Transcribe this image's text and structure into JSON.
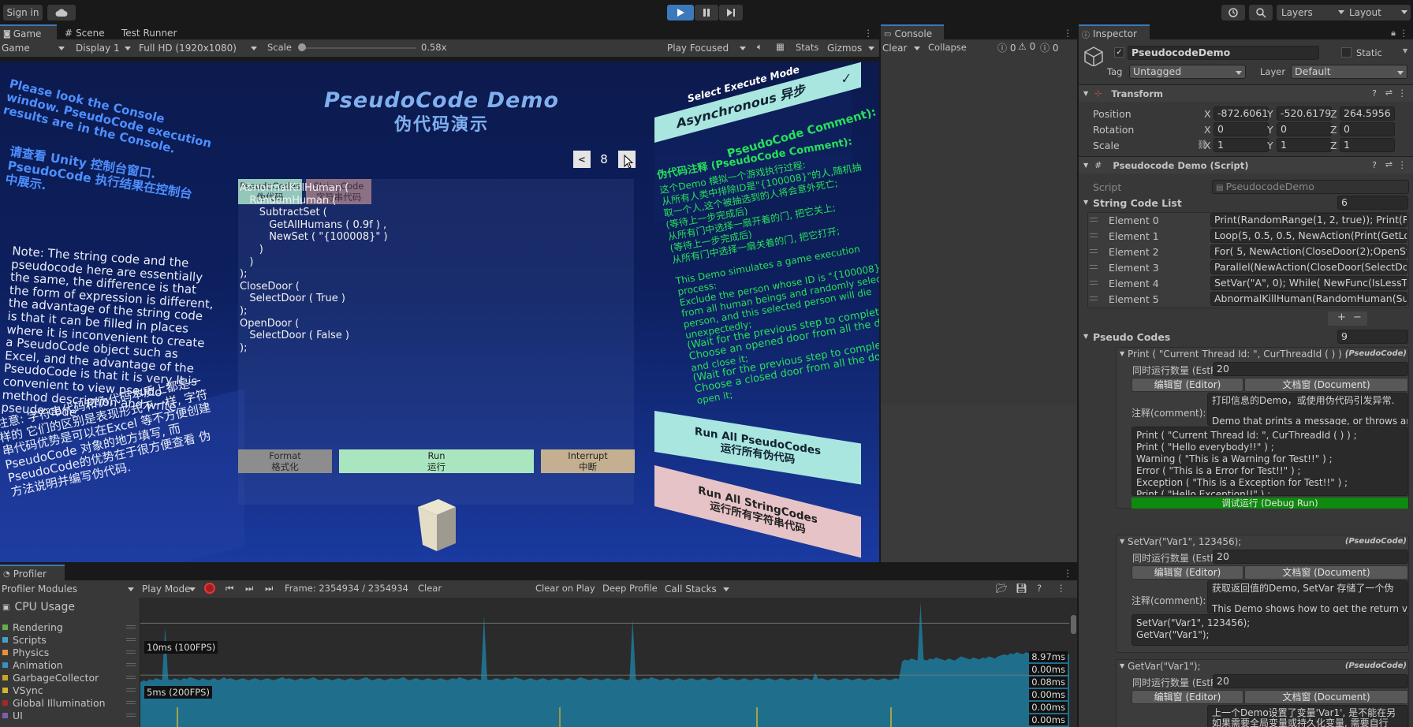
{
  "topbar": {
    "signin": "Sign in",
    "layers": "Layers",
    "layout": "Layout"
  },
  "game": {
    "tab_game": "Game",
    "tab_scene": "Scene",
    "tab_test_runner": "Test Runner",
    "mode": "Game",
    "display": "Display 1",
    "resolution": "Full HD (1920x1080)",
    "scale_label": "Scale",
    "scale_value": "0.58x",
    "play_focused": "Play Focused",
    "stats": "Stats",
    "gizmos": "Gizmos",
    "title_en": "PseudoCode Demo",
    "title_cn": "伪代码演示",
    "left_en": "Please look the Console window. PseudoCode execution results are in the Console.",
    "left_cn": "请查看 Unity 控制台窗口. PseudoCode 执行结果在控制台中展示.",
    "note_en": "Note: The string code and the pseudocode here are essentially the same, the difference is that the form of expression is different, the advantage of the string code is that it can be filled in places where it is inconvenient to create a PseudoCode object such as Excel, and the advantage of the PseudoCode is that it is very It is convenient to view pseudo method description and write pseudo code.",
    "note_cn": "注意: 字符串代码和伪代码本质上都是一样的 它们的区别是表现形式不一样, 字符串代码优势是可以在Excel 等不方便创建 PseudoCode 对象的地方填写, 而PseudoCode的优势在于很方便查看 伪方法说明并编写伪代码.",
    "tab1_en": "PseudoCodes",
    "tab1_cn": "伪代码",
    "tab2_en": "StringCode",
    "tab2_cn": "字符串代码",
    "prev": "<",
    "page": "8",
    "next": ">",
    "code_lines": [
      "AbnormalKillHuman (",
      "   RandomHuman (",
      "      SubtractSet (",
      "         GetAllHumans ( 0.9f ) ,",
      "         NewSet ( \"{100008}\" )",
      "      )",
      "   )",
      ");",
      "CloseDoor (",
      "   SelectDoor ( True )",
      ");",
      "OpenDoor (",
      "   SelectDoor ( False )",
      ");"
    ],
    "format_en": "Format",
    "format_cn": "格式化",
    "run_en": "Run",
    "run_cn": "运行",
    "interrupt_en": "Interrupt",
    "interrupt_cn": "中断",
    "select_mode": "Select Execute Mode",
    "async": "Asynchronous 异步",
    "check": "✓",
    "comment_title": "PseudoCode Comment):",
    "comment_cn": [
      "伪代码注释 (PseudoCode Comment):",
      "这个Demo 模拟一个游戏执行过程:",
      "从所有人类中排除ID是\"{100008}\"的人,随机抽",
      "取一个人,这个被抽选到的人将会意外死亡;",
      "(等待上一步完成后)",
      "从所有门中选择一扇开着的门, 把它关上;",
      "(等待上一步完成后)",
      "从所有门中选择一扇关着的门, 把它打开;"
    ],
    "comment_en": [
      "This Demo simulates a game execution",
      "process:",
      "Exclude the person whose ID is \"{100008}\"",
      "from all human beings and randomly select a",
      "person, and this selected person will die",
      "unexpectedly;",
      "(Wait for the previous step to complete)",
      "Choose an opened door from all the doors",
      "and close it;",
      "(Wait for the previous step to complete)",
      "Choose a closed door from all the doors and",
      "open it;"
    ],
    "run_all_pc_en": "Run All PseudoCodes",
    "run_all_pc_cn": "运行所有伪代码",
    "run_all_sc_en": "Run All StringCodes",
    "run_all_sc_cn": "运行所有字符串代码"
  },
  "console": {
    "tab": "Console",
    "clear": "Clear",
    "collapse": "Collapse",
    "c1": "0",
    "c2": "0",
    "c3": "0"
  },
  "inspector": {
    "tab": "Inspector",
    "object_name": "PseudocodeDemo",
    "static": "Static",
    "tag_label": "Tag",
    "tag": "Untagged",
    "layer_label": "Layer",
    "layer": "Default",
    "transform": "Transform",
    "position_label": "Position",
    "pos": {
      "x": "-872.6061",
      "y": "-520.6179",
      "z": "264.5956"
    },
    "rotation_label": "Rotation",
    "rot": {
      "x": "0",
      "y": "0",
      "z": "0"
    },
    "scale_label": "Scale",
    "scl": {
      "x": "1",
      "y": "1",
      "z": "1"
    },
    "script_component": "Pseudocode Demo (Script)",
    "script_label": "Script",
    "script_value": "PseudocodeDemo",
    "string_code_list": "String Code List",
    "string_code_count": "6",
    "elements": [
      {
        "label": "Element 0",
        "value": "Print(RandomRange(1, 2, true)); Print(Ran"
      },
      {
        "label": "Element 1",
        "value": "Loop(5, 0.5,  0.5, NewAction(Print(GetLo"
      },
      {
        "label": "Element 2",
        "value": "For( 5, NewAction(CloseDoor(2);OpenStr"
      },
      {
        "label": "Element 3",
        "value": "Parallel(NewAction(CloseDoor(SelectDo"
      },
      {
        "label": "Element 4",
        "value": "SetVar(\"A\", 0); While( NewFunc(IsLessTo"
      },
      {
        "label": "Element 5",
        "value": "AbnormalKillHuman(RandomHuman(Sub"
      }
    ],
    "plus": "+",
    "minus": "−",
    "pseudo_codes": "Pseudo Codes",
    "pseudo_count": "9",
    "tag_pc": "(PseudoCode)",
    "concurrent_label": "同时运行数量 (EstRun",
    "concurrent": "20",
    "editor_btn": "编辑窗 (Editor)",
    "doc_btn": "文档窗 (Document)",
    "comment_label": "注释(comment):",
    "pc1_title": "Print ( \"Current Thread Id: \", CurThreadId ( ) ) ;",
    "pc1_comment": "打印信息的Demo，或使用伪代码引发异常.\n\nDemo that prints a message, or throws ar",
    "pc1_code": "Print ( \"Current Thread Id: \", CurThreadId ( ) ) ;\nPrint ( \"Hello everybody!!\" ) ;\nWarning ( \"This is a Warning for Test!!\" ) ;\nError ( \"This is a Error for Test!!\" ) ;\nException ( \"This is a Exception for Test!!\" ) ;\nPrint ( \"Hello Exception!!\" ) ;",
    "debug_run": "调试运行 (Debug Run)",
    "pc2_title": "SetVar(\"Var1\", 123456);",
    "pc2_comment": "获取返回值的Demo, SetVar 存储了一个伪\n\nThis Demo shows how to get the return v",
    "pc2_code": "SetVar(\"Var1\", 123456);\nGetVar(\"Var1\");",
    "pc3_title": "GetVar(\"Var1\");",
    "pc3_comment": "上一个Demo设置了变量'Var1', 是不能在另\n如果需要全局变量或持久化变量, 需要自行"
  },
  "profiler": {
    "tab": "Profiler",
    "modules": "Profiler Modules",
    "play_mode": "Play Mode",
    "frame": "Frame: 2354934 / 2354934",
    "clear": "Clear",
    "clear_on_play": "Clear on Play",
    "deep_profile": "Deep Profile",
    "call_stacks": "Call Stacks",
    "cpu_usage": "CPU Usage",
    "legend": [
      {
        "name": "Rendering",
        "color": "#6aa84f"
      },
      {
        "name": "Scripts",
        "color": "#3fa3c8"
      },
      {
        "name": "Physics",
        "color": "#e69138"
      },
      {
        "name": "Animation",
        "color": "#3a8fc4"
      },
      {
        "name": "GarbageCollector",
        "color": "#c9a227"
      },
      {
        "name": "VSync",
        "color": "#d4b430"
      },
      {
        "name": "Global Illumination",
        "color": "#a32828"
      },
      {
        "name": "UI",
        "color": "#7b5db3"
      }
    ],
    "label_10ms": "10ms (100FPS)",
    "label_5ms": "5ms (200FPS)",
    "readouts": [
      "8.97ms",
      "0.00ms",
      "0.08ms",
      "0.00ms",
      "0.00ms",
      "0.00ms"
    ]
  },
  "chart_data": {
    "type": "area",
    "title": "CPU Usage",
    "ylim": [
      0,
      12
    ],
    "reference_lines": [
      {
        "label": "10ms (100FPS)",
        "y": 10
      },
      {
        "label": "5ms (200FPS)",
        "y": 5
      }
    ],
    "series": [
      {
        "name": "Scripts",
        "values": [
          4.3,
          4.5,
          4.4,
          4.6,
          4.5,
          4.7,
          4.6,
          4.5,
          9.6,
          4.6,
          4.5,
          4.7,
          4.6,
          4.5,
          4.7,
          4.6,
          4.8,
          4.7,
          4.6,
          4.5,
          4.7,
          4.6,
          4.5,
          4.6,
          4.7,
          4.5,
          4.6,
          4.8,
          4.6,
          4.7,
          4.6,
          4.5,
          4.6,
          4.7,
          4.6,
          4.5,
          4.6,
          4.7,
          4.6,
          4.5,
          4.6,
          4.7,
          4.6,
          4.5,
          4.6,
          4.7,
          4.8,
          4.6,
          4.7,
          4.6,
          4.5,
          4.6,
          4.7,
          4.6,
          4.6,
          4.7,
          4.8,
          4.6,
          4.5,
          4.6,
          4.7,
          4.6,
          4.5,
          4.6,
          4.7,
          4.6,
          4.5,
          4.6,
          4.7,
          4.6,
          4.5,
          4.6,
          4.7,
          4.8,
          4.6,
          4.5,
          4.6,
          4.7,
          4.6,
          4.5,
          4.6,
          4.7,
          4.6,
          4.6,
          4.7,
          4.8,
          4.6,
          4.5,
          4.6,
          4.7,
          4.6,
          4.5,
          4.6,
          4.7,
          4.6,
          4.5,
          4.6,
          4.7,
          4.6,
          4.5,
          4.6,
          4.7,
          4.6,
          4.8,
          4.7,
          4.6,
          4.5,
          4.6,
          4.7,
          4.6,
          4.5,
          10.8,
          4.6,
          4.5,
          4.6,
          4.7,
          4.6,
          4.5,
          4.6,
          4.7,
          4.6,
          4.8,
          4.7,
          4.6,
          4.5,
          4.6,
          4.7,
          4.6,
          4.5,
          4.6,
          4.7,
          4.6,
          4.5,
          4.6,
          4.7,
          4.6,
          4.5,
          4.6,
          4.7,
          4.6,
          4.5,
          4.6,
          4.8,
          4.7,
          4.6,
          4.5,
          4.6,
          4.7,
          4.6,
          4.5,
          4.6,
          4.7,
          4.6,
          4.5,
          4.6,
          4.7,
          4.6,
          4.5,
          4.6,
          10.4,
          4.6,
          4.5,
          4.6,
          4.7,
          4.6,
          4.8,
          4.7,
          4.6,
          4.5,
          4.6,
          4.7,
          4.6,
          4.5,
          4.6,
          4.7,
          4.6,
          4.5,
          4.6,
          4.7,
          4.6,
          4.5,
          4.6,
          4.7,
          4.6,
          4.5,
          4.6,
          4.7,
          4.8,
          4.6,
          4.5,
          4.6,
          4.7,
          4.6,
          4.5,
          4.6,
          4.7,
          4.6,
          4.5,
          4.6,
          4.7,
          4.6,
          4.5,
          4.6,
          4.7,
          4.6,
          4.5,
          4.6,
          4.7,
          4.6,
          4.5,
          4.6,
          4.7,
          4.6,
          4.5,
          4.6,
          4.7,
          4.6,
          4.5,
          5.2,
          4.6,
          4.7,
          4.6,
          4.5,
          4.6,
          4.7,
          4.6,
          4.5,
          4.6,
          4.7,
          4.6,
          4.5,
          4.6,
          4.7,
          4.6,
          4.5,
          4.6,
          4.7,
          4.6,
          4.5,
          4.6,
          4.7,
          4.6,
          4.5,
          4.6,
          4.7,
          4.6,
          6.3,
          6.5,
          6.4,
          6.6,
          6.5,
          6.4,
          12.0,
          6.5,
          6.4,
          6.6,
          6.5,
          6.7,
          6.6,
          6.5,
          6.4,
          6.6,
          6.5,
          6.4,
          6.6,
          6.8,
          6.7,
          6.6,
          6.5,
          6.7,
          6.6,
          6.5,
          6.7,
          6.6,
          6.8,
          6.7,
          6.6,
          6.8,
          6.9,
          7.0,
          6.9,
          7.1,
          7.0,
          7.2,
          7.1,
          7.0,
          7.2,
          7.1,
          7.3,
          7.2,
          7.1,
          7.0,
          7.2,
          7.1,
          7.3,
          7.2,
          7.1,
          7.2,
          7.3,
          7.1,
          7.0
        ]
      }
    ]
  }
}
